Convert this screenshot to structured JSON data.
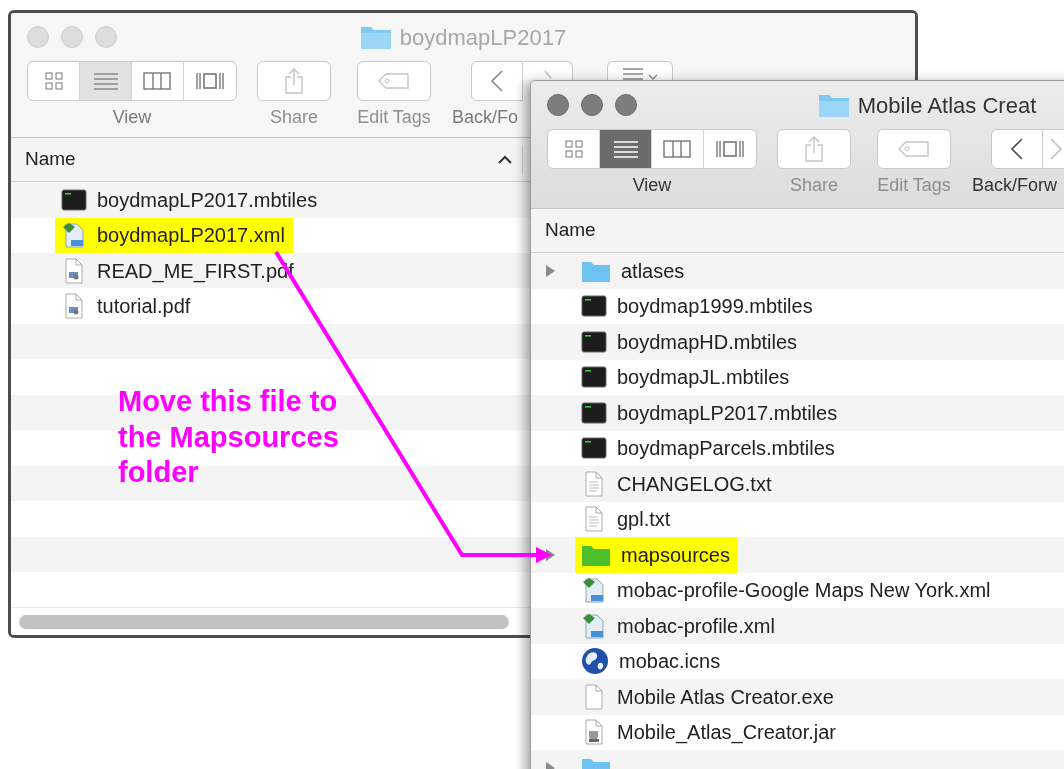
{
  "windows": [
    {
      "title": "boydmapLP2017",
      "active": false,
      "scrollbar": true,
      "toolbar": [
        {
          "kind": "view",
          "label": "View",
          "views": [
            {
              "selected": false
            },
            {
              "selected": true
            },
            {
              "selected": false
            },
            {
              "selected": false
            }
          ]
        },
        {
          "kind": "share",
          "label": "Share",
          "disabled": true
        },
        {
          "kind": "tags",
          "label": "Edit Tags",
          "disabled": true
        },
        {
          "kind": "nav",
          "label": "Back/Fo",
          "disabled": false
        },
        {
          "kind": "arrange",
          "disabled": false
        }
      ],
      "column_header": {
        "label": "Name",
        "sorted": true
      },
      "files": [
        {
          "name": "boydmapLP2017.mbtiles",
          "kind": "exec",
          "highlighted": false,
          "expandable": false
        },
        {
          "name": "boydmapLP2017.xml",
          "kind": "xml",
          "highlighted": true,
          "expandable": false
        },
        {
          "name": "READ_ME_FIRST.pdf",
          "kind": "pdf",
          "highlighted": false,
          "expandable": false
        },
        {
          "name": "tutorial.pdf",
          "kind": "pdf",
          "highlighted": false,
          "expandable": false
        }
      ]
    },
    {
      "title": "Mobile Atlas Creat",
      "active": true,
      "toolbar": [
        {
          "kind": "view",
          "label": "View",
          "views": [
            {
              "selected": false
            },
            {
              "selected": true
            },
            {
              "selected": false
            },
            {
              "selected": false
            }
          ]
        },
        {
          "kind": "share",
          "label": "Share",
          "disabled": true
        },
        {
          "kind": "tags",
          "label": "Edit Tags",
          "disabled": true
        },
        {
          "kind": "nav",
          "label": "Back/Forw",
          "disabled": false
        }
      ],
      "column_header": {
        "label": "Name",
        "sorted": false
      },
      "files": [
        {
          "name": "atlases",
          "kind": "folder",
          "color": "#6cc3f2",
          "highlighted": false,
          "expandable": true
        },
        {
          "name": "boydmap1999.mbtiles",
          "kind": "exec",
          "highlighted": false,
          "expandable": false
        },
        {
          "name": "boydmapHD.mbtiles",
          "kind": "exec",
          "highlighted": false,
          "expandable": false
        },
        {
          "name": "boydmapJL.mbtiles",
          "kind": "exec",
          "highlighted": false,
          "expandable": false
        },
        {
          "name": "boydmapLP2017.mbtiles",
          "kind": "exec",
          "highlighted": false,
          "expandable": false
        },
        {
          "name": "boydmapParcels.mbtiles",
          "kind": "exec",
          "highlighted": false,
          "expandable": false
        },
        {
          "name": "CHANGELOG.txt",
          "kind": "text",
          "highlighted": false,
          "expandable": false
        },
        {
          "name": "gpl.txt",
          "kind": "text",
          "highlighted": false,
          "expandable": false
        },
        {
          "name": "mapsources",
          "kind": "folder",
          "color": "#4cbf2a",
          "highlighted": true,
          "expandable": true
        },
        {
          "name": "mobac-profile-Google Maps New York.xml",
          "kind": "xml",
          "highlighted": false,
          "expandable": false
        },
        {
          "name": "mobac-profile.xml",
          "kind": "xml",
          "highlighted": false,
          "expandable": false
        },
        {
          "name": "mobac.icns",
          "kind": "globe",
          "highlighted": false,
          "expandable": false
        },
        {
          "name": "Mobile Atlas Creator.exe",
          "kind": "blank",
          "highlighted": false,
          "expandable": false
        },
        {
          "name": "Mobile_Atlas_Creator.jar",
          "kind": "jar",
          "highlighted": false,
          "expandable": false
        },
        {
          "kind": "folder",
          "color": "#6cc3f2",
          "highlighted": false,
          "expandable": true
        }
      ]
    }
  ],
  "annotation": {
    "text": "Move this file to the Mapsources folder"
  }
}
